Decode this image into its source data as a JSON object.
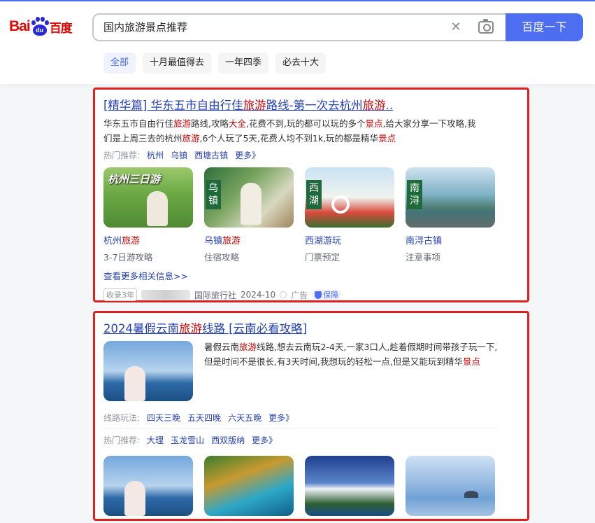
{
  "logo": {
    "text_bai": "Bai",
    "text_du": "du",
    "text_baidu": "百度"
  },
  "search": {
    "query": "国内旅游景点推荐",
    "button_label": "百度一下"
  },
  "tabs": [
    {
      "label": "全部",
      "active": true
    },
    {
      "label": "十月最值得去",
      "active": false
    },
    {
      "label": "一年四季",
      "active": false
    },
    {
      "label": "必去十大",
      "active": false
    }
  ],
  "result1": {
    "title_parts": [
      "[精华篇] 华东五市自由行佳",
      "旅游",
      "路线-第一次去杭州",
      "旅游",
      ".."
    ],
    "snippet_line1_parts": [
      "华东五市自由行佳",
      "旅游",
      "路线,攻略",
      "大全",
      ",花费不到,玩的都可以玩的多个",
      "景点",
      ",给大家分享一下攻略,我"
    ],
    "snippet_line2_parts": [
      "们是上周三去的杭州",
      "旅游",
      ",6个人玩了5天,花费人均不到1k,玩的都是精华",
      "景点"
    ],
    "hot_label": "热门推荐:",
    "hot_links": [
      "杭州",
      "乌镇",
      "西塘古镇",
      "更多》"
    ],
    "thumbs": [
      {
        "overlay": "杭州三日游",
        "cap_main": "杭州",
        "cap_hl": "旅游",
        "sub": "3-7日游攻略"
      },
      {
        "overlay": "乌镇",
        "cap_main": "乌镇",
        "cap_hl": "旅游",
        "sub": "住宿攻略"
      },
      {
        "overlay": "西湖",
        "cap_main": "西湖游玩",
        "cap_hl": "",
        "sub": "门票预定"
      },
      {
        "overlay": "南浔",
        "cap_main": "南浔古镇",
        "cap_hl": "",
        "sub": "注意事项"
      }
    ],
    "see_more": "查看更多相关信息>>",
    "source_badge": "收录3年",
    "source_agency": "国际旅行社",
    "source_date": "2024-10",
    "ad_label": "广告",
    "protect_label": "保障"
  },
  "result2": {
    "title_parts": [
      "2024暑假云南",
      "旅游",
      "线路 [云南必看攻略]"
    ],
    "snippet_parts": [
      "暑假云南",
      "旅游",
      "线路,想去云南玩2-4天,一家3口人,趁着假期时间带孩子玩一下,但是时间不是很长,有3天时间,我想玩的轻松一点,但是又能玩到精华",
      "景点"
    ],
    "route_label": "线路玩法:",
    "route_links": [
      "四天三晚",
      "五天四晚",
      "六天五晚",
      "更多》"
    ],
    "hot_label": "热门推荐:",
    "hot_links": [
      "大理",
      "玉龙雪山",
      "西双版纳",
      "更多》"
    ]
  }
}
